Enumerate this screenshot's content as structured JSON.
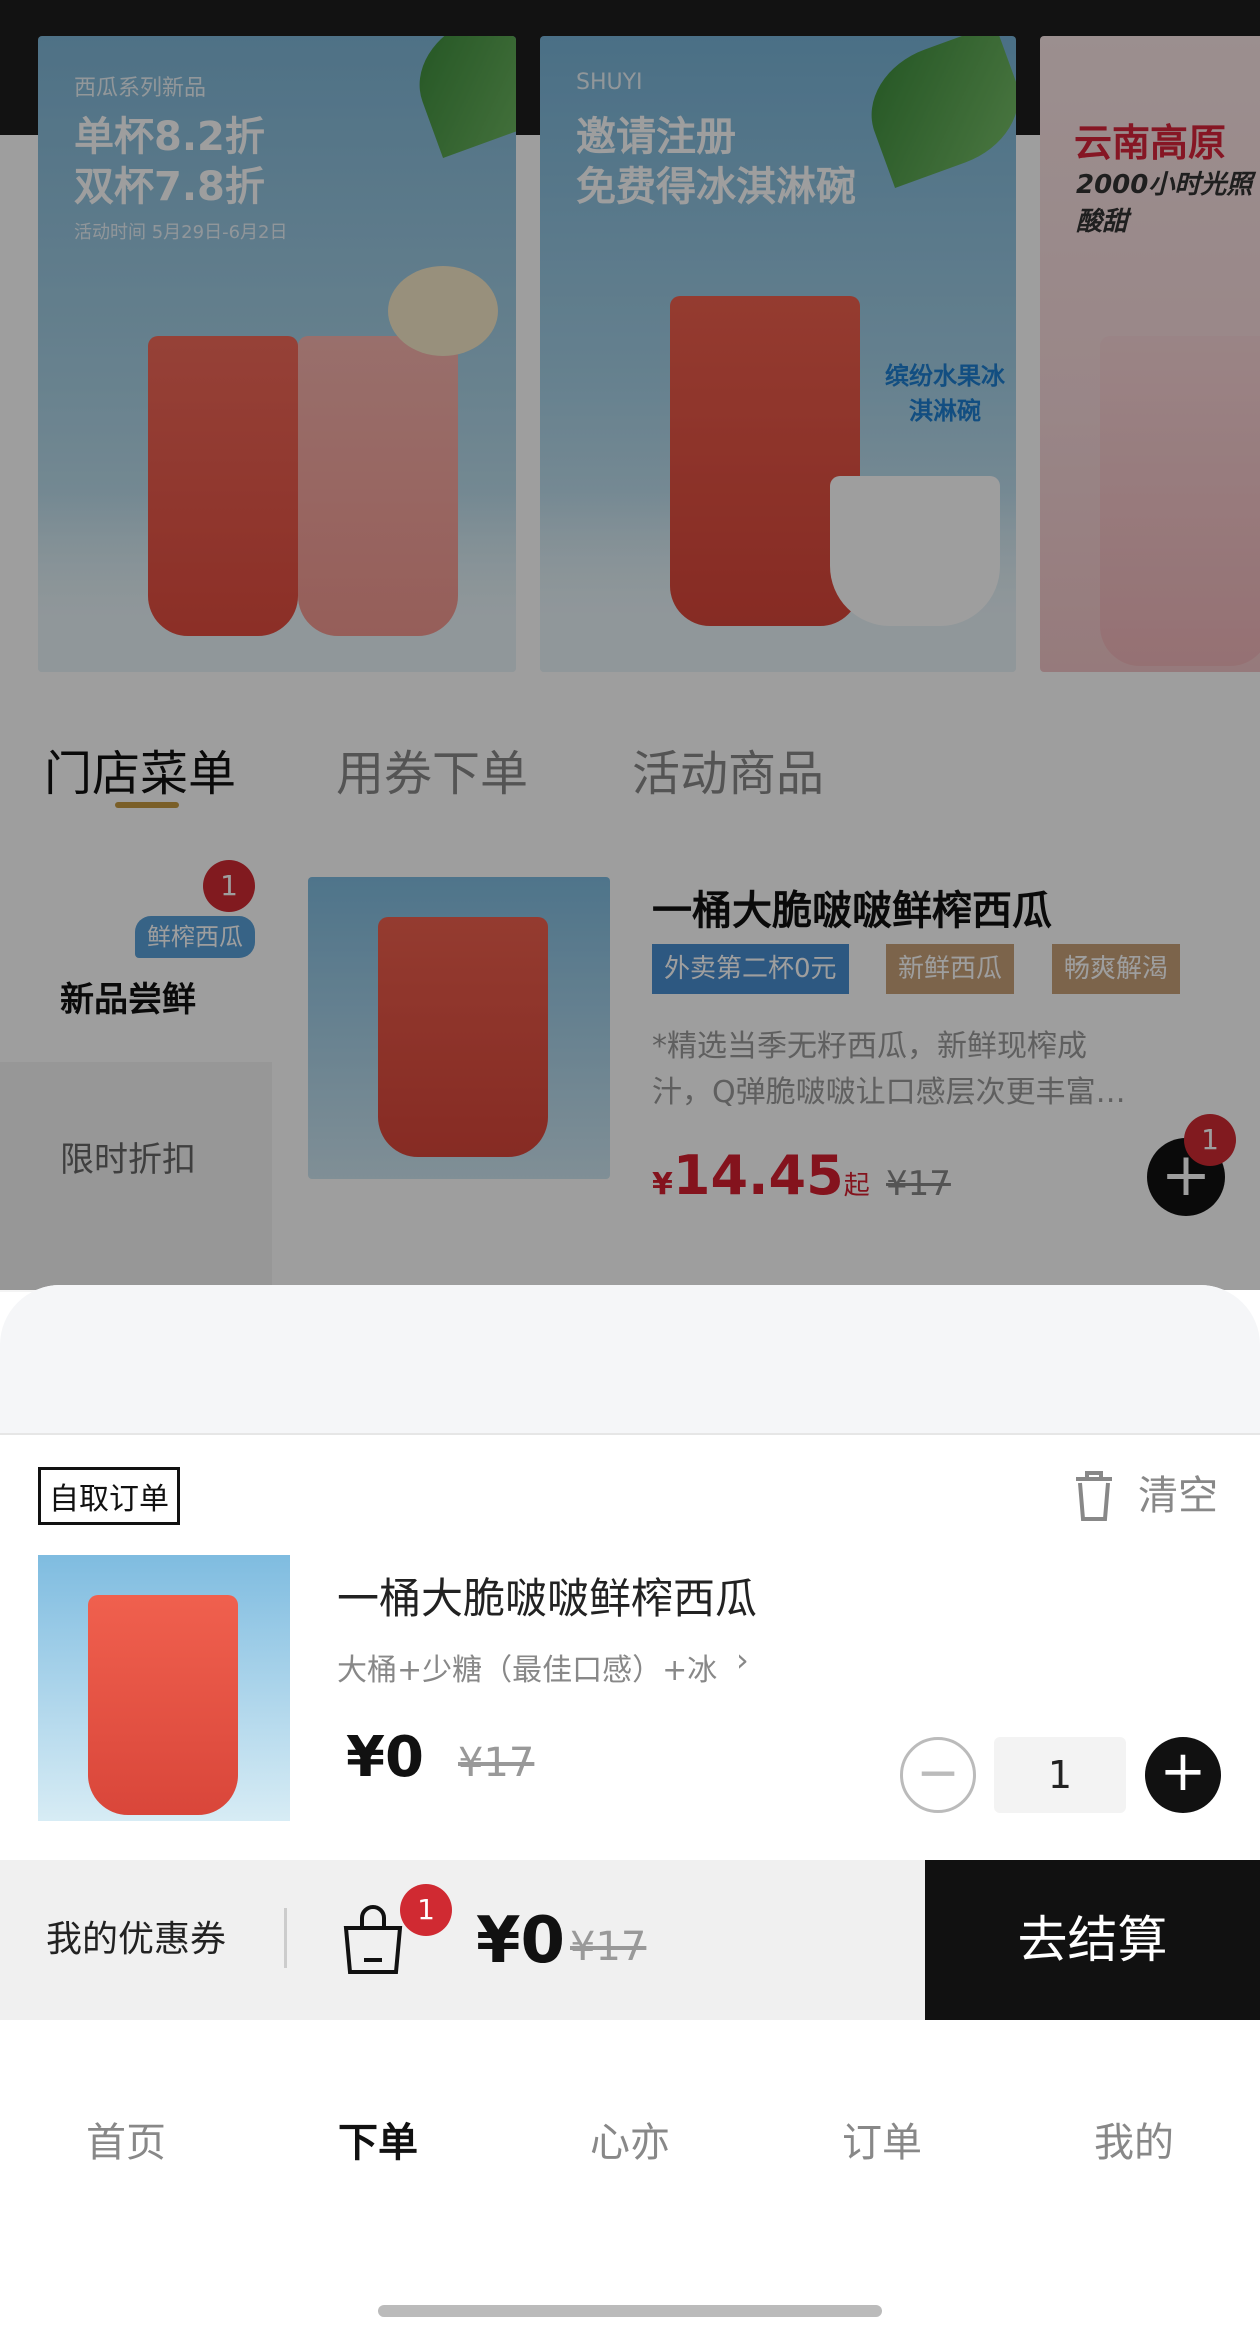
{
  "banners": [
    {
      "small": "西瓜系列新品",
      "headline_1": "单杯8.2折",
      "headline_2": "双杯7.8折",
      "date": "活动时间 5月29日-6月2日"
    },
    {
      "small": "SHUYI",
      "headline_1": "邀请注册",
      "headline_2": "免费得冰淇淋碗",
      "sticker": "缤纷水果冰淇淋碗"
    },
    {
      "headline_1": "云南高原",
      "headline_2": "2000小时光照 酸甜"
    }
  ],
  "tabs": [
    {
      "label": "门店菜单",
      "active": true
    },
    {
      "label": "用券下单",
      "active": false
    },
    {
      "label": "活动商品",
      "active": false
    }
  ],
  "categories": {
    "active": {
      "badge": "1",
      "pill": "鲜榨西瓜",
      "label": "新品尝鲜"
    },
    "others": [
      {
        "label": "限时折扣"
      }
    ]
  },
  "product": {
    "title": "一桶大脆啵啵鲜榨西瓜",
    "tags": [
      "外卖第二杯0元",
      "新鲜西瓜",
      "畅爽解渴"
    ],
    "desc_line1": "*精选当季无籽西瓜，新鲜现榨成",
    "desc_line2": "汁，Q弹脆啵啵让口感层次更丰富…",
    "price_currency": "¥",
    "price": "14.45",
    "price_suffix": "起",
    "original_price": "¥17",
    "add_icon": "+",
    "cart_badge": "1"
  },
  "cart": {
    "order_type": "自取订单",
    "clear_label": "清空",
    "item": {
      "title": "一桶大脆啵啵鲜榨西瓜",
      "spec": "大桶+少糖（最佳口感）+冰",
      "price": "¥0",
      "original_price": "¥17",
      "quantity": "1",
      "minus_icon": "−",
      "plus_icon": "+"
    }
  },
  "checkout": {
    "coupon_label": "我的优惠券",
    "bag_badge": "1",
    "total": "¥0",
    "original_total": "¥17",
    "button": "去结算"
  },
  "nav": [
    {
      "label": "首页",
      "active": false
    },
    {
      "label": "下单",
      "active": true
    },
    {
      "label": "心亦",
      "active": false
    },
    {
      "label": "订单",
      "active": false
    },
    {
      "label": "我的",
      "active": false
    }
  ],
  "colors": {
    "accent_gold": "#c69a42",
    "badge_red": "#d02a32",
    "price_red": "#d61f2f",
    "tag_blue": "#4a8fd0",
    "tag_tan": "#c8a27a"
  }
}
